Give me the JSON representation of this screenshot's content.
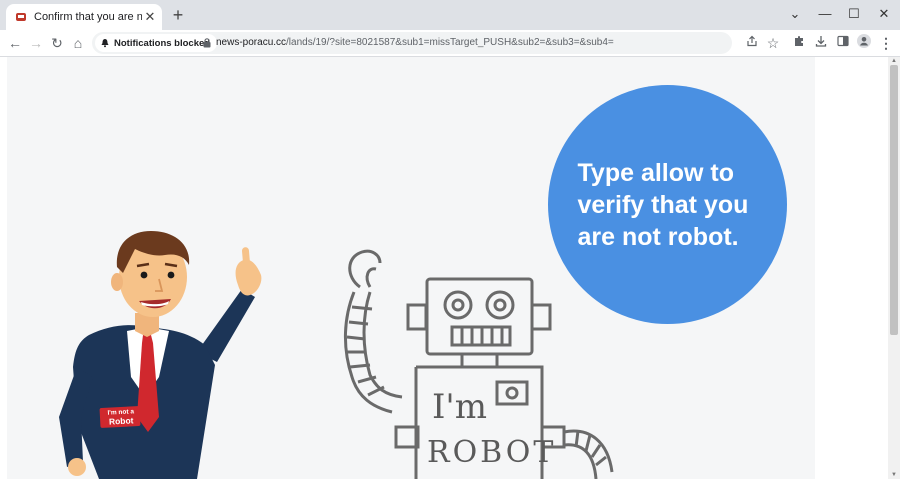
{
  "browser": {
    "tab_title": "Confirm that you are not a robot",
    "notifications_chip": "Notifications blocked",
    "url_host": "news-poracu.cc",
    "url_path": "/lands/19/?site=8021587&sub1=missTarget_PUSH&sub2=&sub3=&sub4="
  },
  "page": {
    "message": "Type allow to verify that you are not robot.",
    "badge_line1": "I'm not a",
    "badge_line2": "Robot",
    "robot_text_1": "I'm",
    "robot_text_2": "ROBOT"
  },
  "colors": {
    "circle": "#4a90e2",
    "page_bg": "#f5f6f7",
    "suit": "#1c3557",
    "tie": "#d0282e"
  }
}
